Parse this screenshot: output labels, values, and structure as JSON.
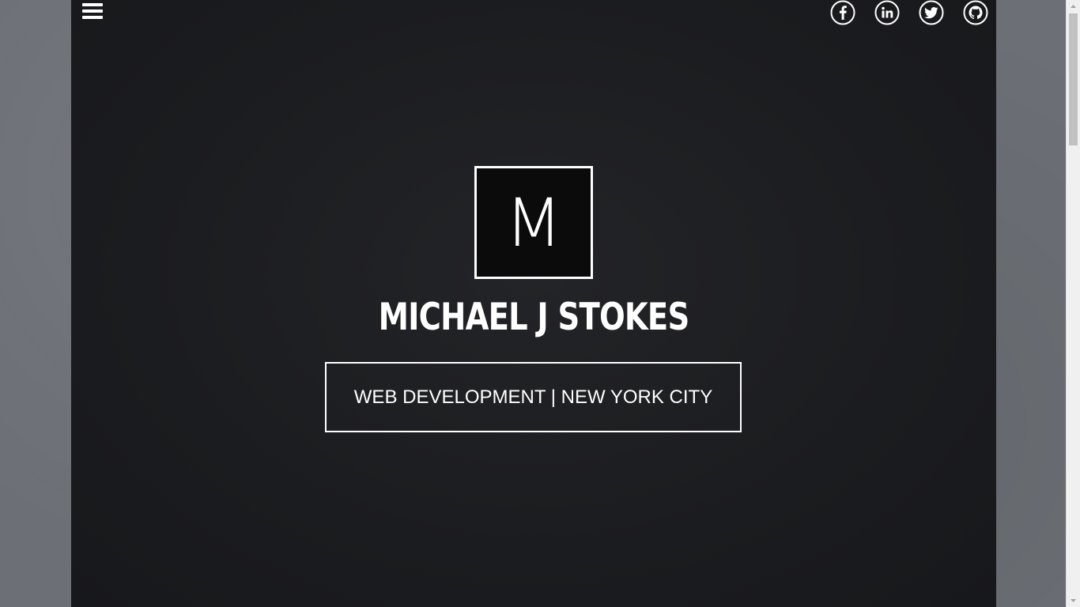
{
  "header": {
    "menu_label": "Menu",
    "social_links": [
      {
        "name": "facebook",
        "icon": "facebook-icon"
      },
      {
        "name": "linkedin",
        "icon": "linkedin-icon"
      },
      {
        "name": "twitter",
        "icon": "twitter-icon"
      },
      {
        "name": "github",
        "icon": "github-icon"
      }
    ]
  },
  "hero": {
    "logo_letter": "M",
    "name": "MICHAEL J STOKES",
    "tagline": "WEB DEVELOPMENT | NEW YORK CITY"
  },
  "colors": {
    "page_background": "#1c1d20",
    "outer_background": "#6c7076",
    "text": "#ffffff",
    "logo_fill": "#0b0b0c"
  }
}
